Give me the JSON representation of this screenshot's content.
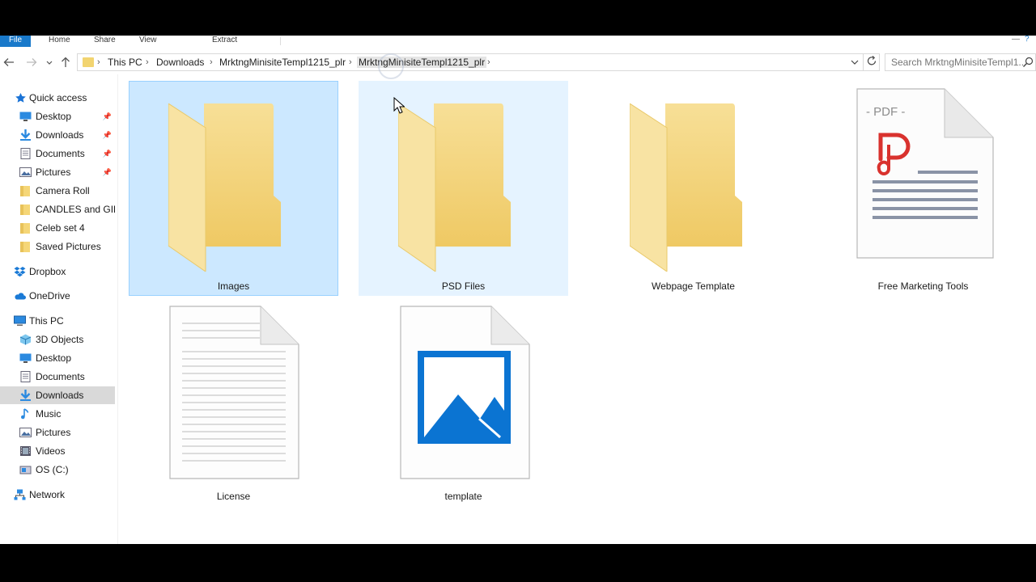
{
  "ribbon": {
    "tabs": [
      "File",
      "Home",
      "Share",
      "View",
      "Extract"
    ],
    "minimize_glyph": "—",
    "help_glyph": "?"
  },
  "address": {
    "crumbs": [
      "This PC",
      "Downloads",
      "MrktngMinisiteTempl1215_plr",
      "MrktngMinisiteTempl1215_plr"
    ]
  },
  "search": {
    "placeholder": "Search MrktngMinisiteTempl1..."
  },
  "sidebar": {
    "quick_access": "Quick access",
    "quick_items": [
      "Desktop",
      "Downloads",
      "Documents",
      "Pictures",
      "Camera Roll",
      "CANDLES and GIFTS",
      "Celeb set 4",
      "Saved Pictures"
    ],
    "dropbox": "Dropbox",
    "onedrive": "OneDrive",
    "this_pc": "This PC",
    "pc_items": [
      "3D Objects",
      "Desktop",
      "Documents",
      "Downloads",
      "Music",
      "Pictures",
      "Videos",
      "OS (C:)"
    ],
    "network": "Network",
    "selected": "Downloads"
  },
  "files": [
    {
      "name": "Images",
      "type": "folder",
      "state": "selected"
    },
    {
      "name": "PSD Files",
      "type": "folder",
      "state": "hover"
    },
    {
      "name": "Webpage Template",
      "type": "folder",
      "state": "none"
    },
    {
      "name": "Free Marketing Tools",
      "type": "pdf",
      "state": "none",
      "badge": "PDF"
    },
    {
      "name": "License",
      "type": "text",
      "state": "none"
    },
    {
      "name": "template",
      "type": "image",
      "state": "none"
    }
  ],
  "colors": {
    "file_tab": "#1979ca",
    "selection_bg": "#cce8ff",
    "hover_bg": "#e5f3ff",
    "folder_front": "#f5d677",
    "pdf_red": "#d9322e",
    "image_blue": "#0b74d2"
  }
}
